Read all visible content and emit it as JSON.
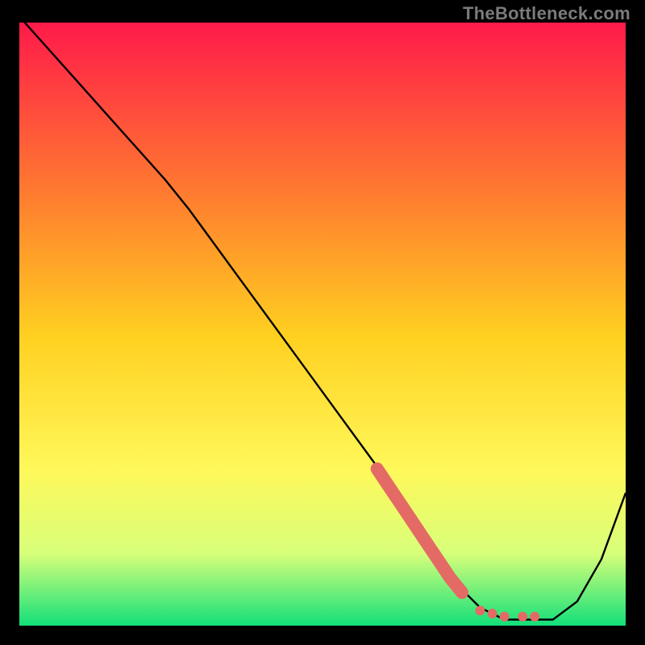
{
  "watermark": "TheBottleneck.com",
  "colors": {
    "gradient_top": "#ff1a4a",
    "gradient_mid1": "#ff7a30",
    "gradient_mid2": "#ffd020",
    "gradient_mid3": "#fff85a",
    "gradient_mid4": "#d8ff7a",
    "gradient_bottom": "#13e07a",
    "curve": "#000000",
    "marker": "#e46a65",
    "frame": "#000000"
  },
  "chart_data": {
    "type": "line",
    "title": "",
    "xlabel": "",
    "ylabel": "",
    "xlim": [
      0,
      100
    ],
    "ylim": [
      0,
      100
    ],
    "series": [
      {
        "name": "bottleneck-curve",
        "x": [
          0,
          8,
          16,
          24,
          28,
          36,
          44,
          52,
          60,
          66,
          72,
          76,
          80,
          84,
          88,
          92,
          96,
          100
        ],
        "y": [
          101,
          92,
          83,
          74,
          69,
          58,
          47,
          36,
          25,
          16,
          7,
          3,
          1,
          1,
          1,
          4,
          11,
          22
        ]
      }
    ],
    "markers": [
      {
        "name": "highlight-segment",
        "points": [
          {
            "x": 59,
            "y": 26
          },
          {
            "x": 61,
            "y": 23
          },
          {
            "x": 63,
            "y": 20
          },
          {
            "x": 65,
            "y": 17
          },
          {
            "x": 67,
            "y": 14
          },
          {
            "x": 69,
            "y": 11
          },
          {
            "x": 71,
            "y": 8
          },
          {
            "x": 73,
            "y": 5.5
          }
        ]
      },
      {
        "name": "valley-dots",
        "points": [
          {
            "x": 76,
            "y": 2.5
          },
          {
            "x": 78,
            "y": 2.0
          },
          {
            "x": 80,
            "y": 1.5
          },
          {
            "x": 83,
            "y": 1.5
          },
          {
            "x": 85,
            "y": 1.5
          }
        ]
      }
    ]
  }
}
